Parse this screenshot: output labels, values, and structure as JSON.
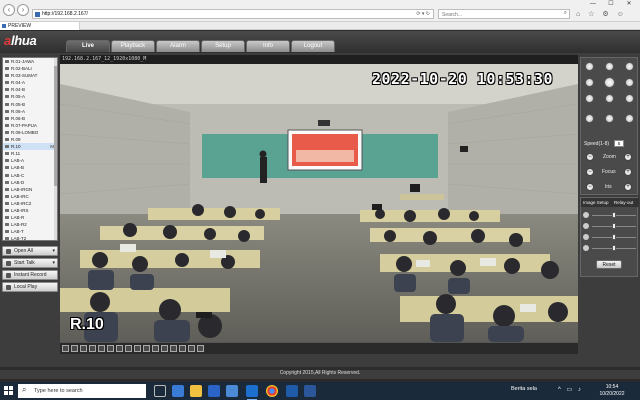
{
  "browser": {
    "url": "http://192.168.2.167/",
    "search_placeholder": "Search...",
    "tab_label": "PREVIEW",
    "nav_back": "‹",
    "nav_forward": "›",
    "address_tools": "⟳ ▾ ↻",
    "search_glyph": "⌕",
    "toolbar_glyphs": "⌂ ☆ ⚙ ☺",
    "window_buttons": {
      "minimize": "—",
      "maximize": "☐",
      "close": "✕"
    }
  },
  "app": {
    "logo_accent": "a",
    "logo_rest": "lhua",
    "tabs": [
      {
        "label": "Live"
      },
      {
        "label": "Playback"
      },
      {
        "label": "Alarm"
      },
      {
        "label": "Setup"
      },
      {
        "label": "Info"
      },
      {
        "label": "Logout"
      }
    ],
    "channels": [
      {
        "label": "R.01-JAWA",
        "flag": ""
      },
      {
        "label": "R.02-BALI",
        "flag": ""
      },
      {
        "label": "R.03-SUMAT",
        "flag": ""
      },
      {
        "label": "R.04-A",
        "flag": ""
      },
      {
        "label": "R.04-B",
        "flag": ""
      },
      {
        "label": "R.05-A",
        "flag": ""
      },
      {
        "label": "R.05-B",
        "flag": ""
      },
      {
        "label": "R.06-A",
        "flag": ""
      },
      {
        "label": "R.06-B",
        "flag": ""
      },
      {
        "label": "R.07-PAPUA",
        "flag": ""
      },
      {
        "label": "R.08-LOMBO",
        "flag": ""
      },
      {
        "label": "R.09",
        "flag": ""
      },
      {
        "label": "R.10",
        "flag": "M"
      },
      {
        "label": "R.11",
        "flag": ""
      },
      {
        "label": "LAB-A",
        "flag": ""
      },
      {
        "label": "LAB-B",
        "flag": ""
      },
      {
        "label": "LAB-C",
        "flag": ""
      },
      {
        "label": "LAB-D",
        "flag": ""
      },
      {
        "label": "LAB-IRGN",
        "flag": ""
      },
      {
        "label": "LAB-IRC",
        "flag": ""
      },
      {
        "label": "LAB-IRC2",
        "flag": ""
      },
      {
        "label": "LAB-IRS",
        "flag": ""
      },
      {
        "label": "LAB-R",
        "flag": ""
      },
      {
        "label": "LAB-R2",
        "flag": ""
      },
      {
        "label": "LAB-T",
        "flag": ""
      },
      {
        "label": "LAB-T2",
        "flag": ""
      }
    ],
    "actions": [
      {
        "label": "Open All",
        "caret": "▾"
      },
      {
        "label": "Start Talk",
        "caret": "▾"
      },
      {
        "label": "Instant Record",
        "caret": ""
      },
      {
        "label": "Local Play",
        "caret": ""
      }
    ],
    "stream_info": "192.168.2.167_12_1920x1080_M",
    "osd_time": "2022-10-20 10:53:30",
    "osd_name": "R.10",
    "ptz": {
      "speed_label": "Speed(1-8)",
      "speed_value": "5",
      "zoom_label": "Zoom",
      "focus_label": "Focus",
      "iris_label": "Iris",
      "minus_glyph": "−",
      "plus_glyph": "+"
    },
    "image_setup": {
      "tab_active": "Image Setup",
      "tab_other": "Relay-out",
      "sliders": [
        0.5,
        0.5,
        0.5,
        0.5
      ],
      "reset_label": "Reset"
    },
    "copyright": "Copyright 2015,All Rights Reserved."
  },
  "taskbar": {
    "search_placeholder": "Type here to search",
    "search_glyph": "⌕",
    "weather": "Berita sela",
    "tray_glyphs": "^ ▭ ♪",
    "time": "10:54",
    "date": "10/20/2022"
  },
  "colors": {
    "app_background": "#3d3d3d",
    "logo_accent": "#e23a3a",
    "taskbar": "#1b2a3a",
    "selected_channel": "#cfe1f5"
  }
}
